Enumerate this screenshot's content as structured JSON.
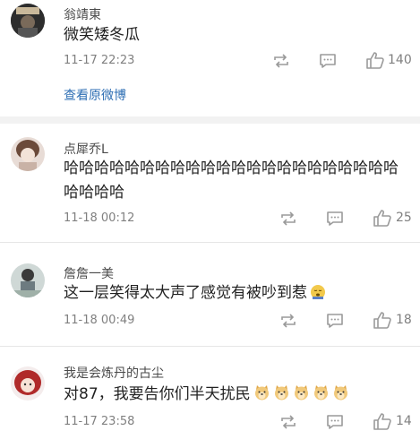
{
  "comments": [
    {
      "user": "翁靖東",
      "text": "微笑矮冬瓜",
      "time": "11-17 22:23",
      "likes": "140",
      "avatar": "user-avatar",
      "link": "查看原微博"
    },
    {
      "user": "点犀乔L",
      "text": "哈哈哈哈哈哈哈哈哈哈哈哈哈哈哈哈哈哈哈哈哈哈哈哈哈哈",
      "time": "11-18 00:12",
      "likes": "25",
      "avatar": "user-avatar"
    },
    {
      "user": "詹詹一美",
      "text": "这一层笑得太大声了感觉有被吵到惹",
      "time": "11-18 00:49",
      "likes": "18",
      "avatar": "user-avatar",
      "emoji": "sleepy-face-emoji"
    },
    {
      "user": "我是会炼丹的古尘",
      "text": "对87，我要告你们半天扰民",
      "time": "11-17 23:58",
      "likes": "14",
      "avatar": "user-avatar",
      "emoji": "doge-emoji",
      "emoji_count": 5
    }
  ],
  "icons": {
    "repost": "repost-icon",
    "comment": "comment-icon",
    "like": "like-icon"
  },
  "colors": {
    "link": "#2f6fb4",
    "meta": "#808080",
    "separator": "#e6e6e6"
  }
}
